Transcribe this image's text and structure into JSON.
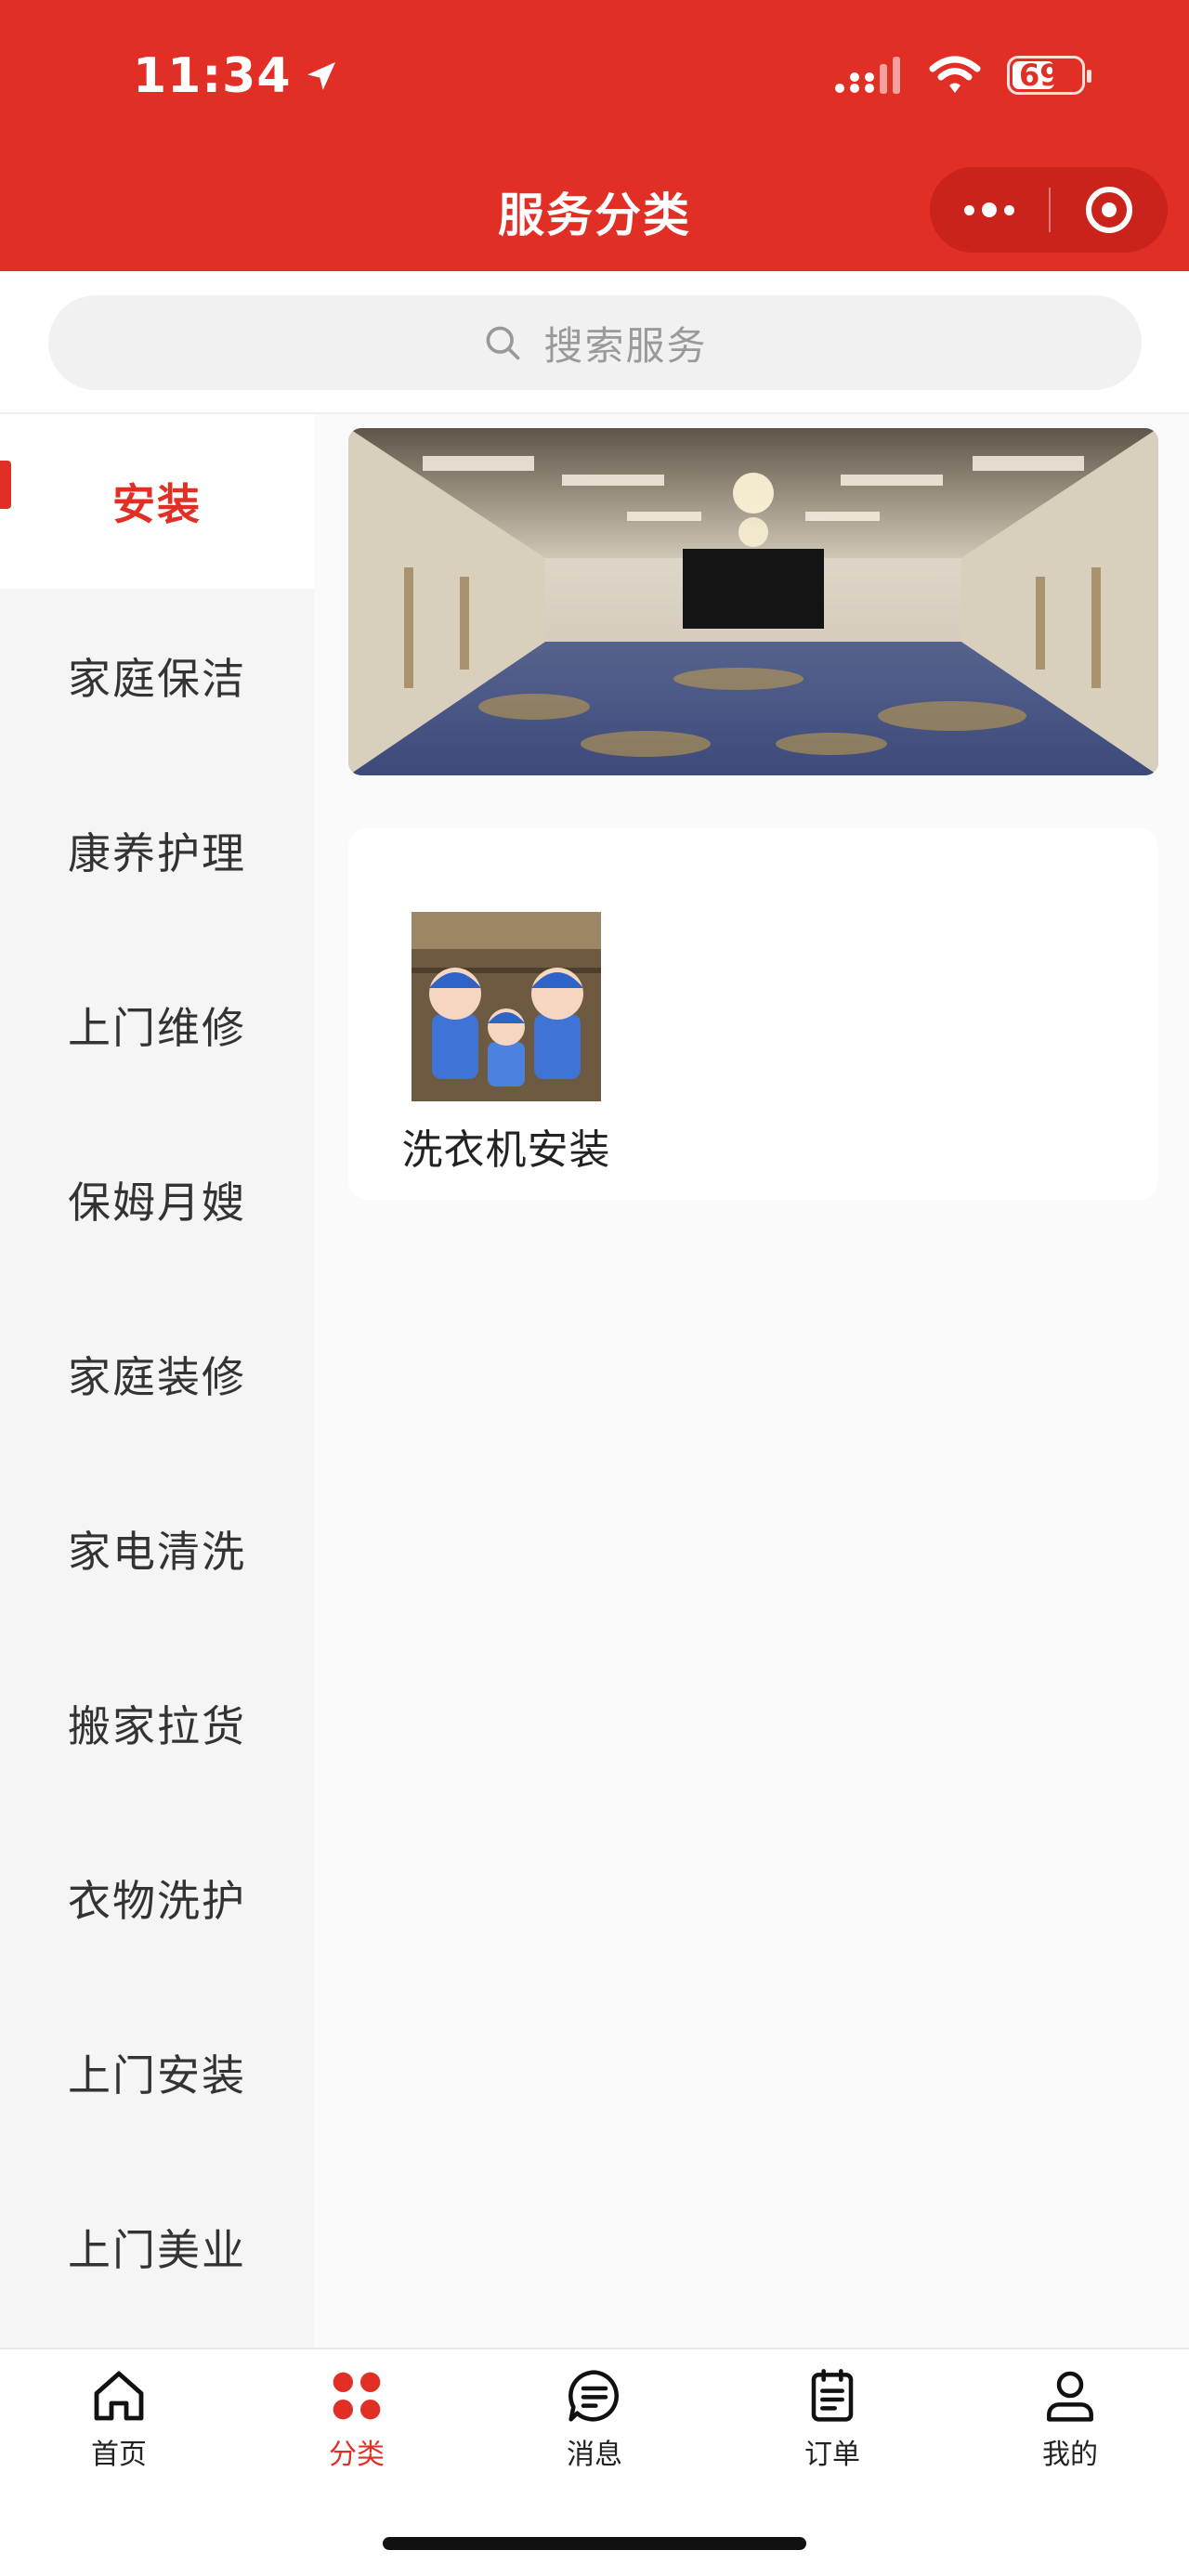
{
  "status_bar": {
    "time": "11:34",
    "battery": "69"
  },
  "header": {
    "title": "服务分类"
  },
  "search": {
    "placeholder": "搜索服务"
  },
  "categories": [
    {
      "label": "安装",
      "active": true
    },
    {
      "label": "家庭保洁",
      "active": false
    },
    {
      "label": "康养护理",
      "active": false
    },
    {
      "label": "上门维修",
      "active": false
    },
    {
      "label": "保姆月嫂",
      "active": false
    },
    {
      "label": "家庭装修",
      "active": false
    },
    {
      "label": "家电清洗",
      "active": false
    },
    {
      "label": "搬家拉货",
      "active": false
    },
    {
      "label": "衣物洗护",
      "active": false
    },
    {
      "label": "上门安装",
      "active": false
    },
    {
      "label": "上门美业",
      "active": false
    }
  ],
  "services": [
    {
      "name": "洗衣机安装"
    }
  ],
  "tabbar": {
    "items": [
      {
        "label": "首页",
        "icon": "home-icon"
      },
      {
        "label": "分类",
        "icon": "category-icon",
        "active": true
      },
      {
        "label": "消息",
        "icon": "message-icon"
      },
      {
        "label": "订单",
        "icon": "order-icon"
      },
      {
        "label": "我的",
        "icon": "user-icon"
      }
    ]
  },
  "colors": {
    "accent": "#e22f26",
    "sidebar_bg": "#f5f5f5",
    "content_bg": "#fafafa"
  }
}
